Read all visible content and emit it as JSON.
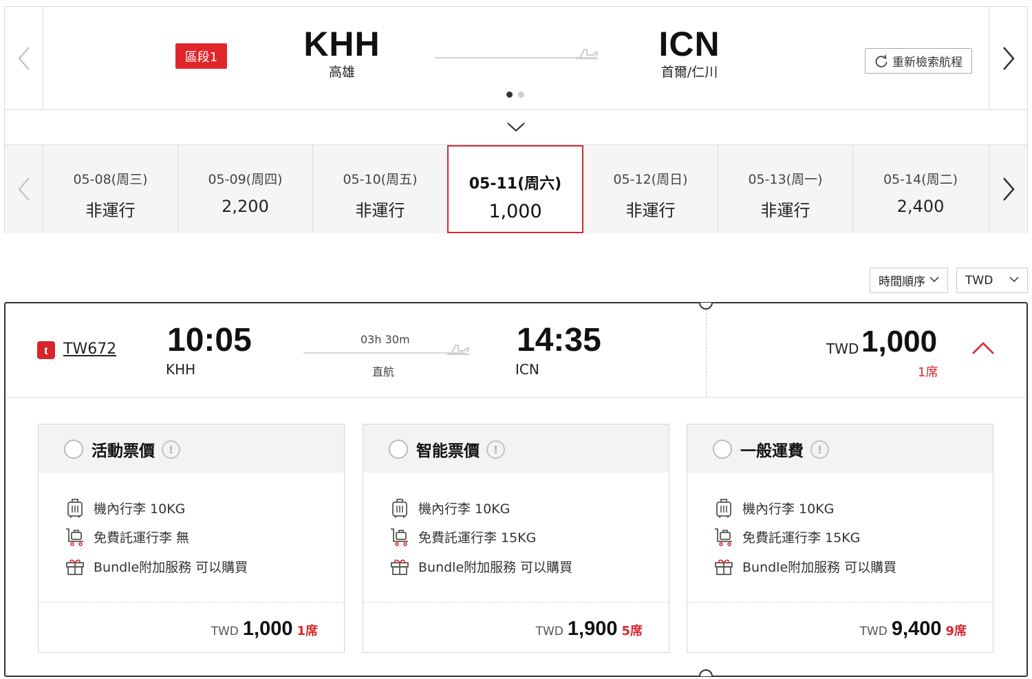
{
  "segment": {
    "badge": "區段1",
    "origin": {
      "code": "KHH",
      "city": "高雄"
    },
    "destination": {
      "code": "ICN",
      "city": "首爾/仁川"
    },
    "research_label": "重新檢索航程"
  },
  "dates": [
    {
      "label": "05-08(周三)",
      "value": "非運行"
    },
    {
      "label": "05-09(周四)",
      "value": "2,200"
    },
    {
      "label": "05-10(周五)",
      "value": "非運行"
    },
    {
      "label": "05-11(周六)",
      "value": "1,000",
      "selected": true
    },
    {
      "label": "05-12(周日)",
      "value": "非運行"
    },
    {
      "label": "05-13(周一)",
      "value": "非運行"
    },
    {
      "label": "05-14(周二)",
      "value": "2,400"
    }
  ],
  "sort": {
    "order": "時間順序",
    "currency": "TWD"
  },
  "flight": {
    "number": "TW672",
    "dep_time": "10:05",
    "dep_port": "KHH",
    "arr_time": "14:35",
    "arr_port": "ICN",
    "duration": "03h 30m",
    "type": "直航",
    "currency": "TWD",
    "price": "1,000",
    "seats": "1席"
  },
  "fares": [
    {
      "title": "活動票價",
      "carry_on": "機內行李 10KG",
      "checked": "免費託運行李 無",
      "bundle": "Bundle附加服務 可以購買",
      "currency": "TWD",
      "price": "1,000",
      "seats": "1席"
    },
    {
      "title": "智能票價",
      "carry_on": "機內行李 10KG",
      "checked": "免費託運行李 15KG",
      "bundle": "Bundle附加服務 可以購買",
      "currency": "TWD",
      "price": "1,900",
      "seats": "5席"
    },
    {
      "title": "一般運費",
      "carry_on": "機內行李 10KG",
      "checked": "免費託運行李 15KG",
      "bundle": "Bundle附加服務 可以購買",
      "currency": "TWD",
      "price": "9,400",
      "seats": "9席"
    }
  ],
  "icons": {
    "prev": "chevron-left-icon",
    "next": "chevron-right-icon",
    "expand": "chevron-down-icon",
    "collapse": "chevron-up-icon",
    "plane": "plane-icon",
    "refresh": "refresh-icon",
    "carry_on": "carry-on-bag-icon",
    "checked": "luggage-cart-icon",
    "bundle": "gift-icon",
    "info": "info-icon"
  },
  "colors": {
    "accent": "#d9262c",
    "text": "#111111"
  }
}
